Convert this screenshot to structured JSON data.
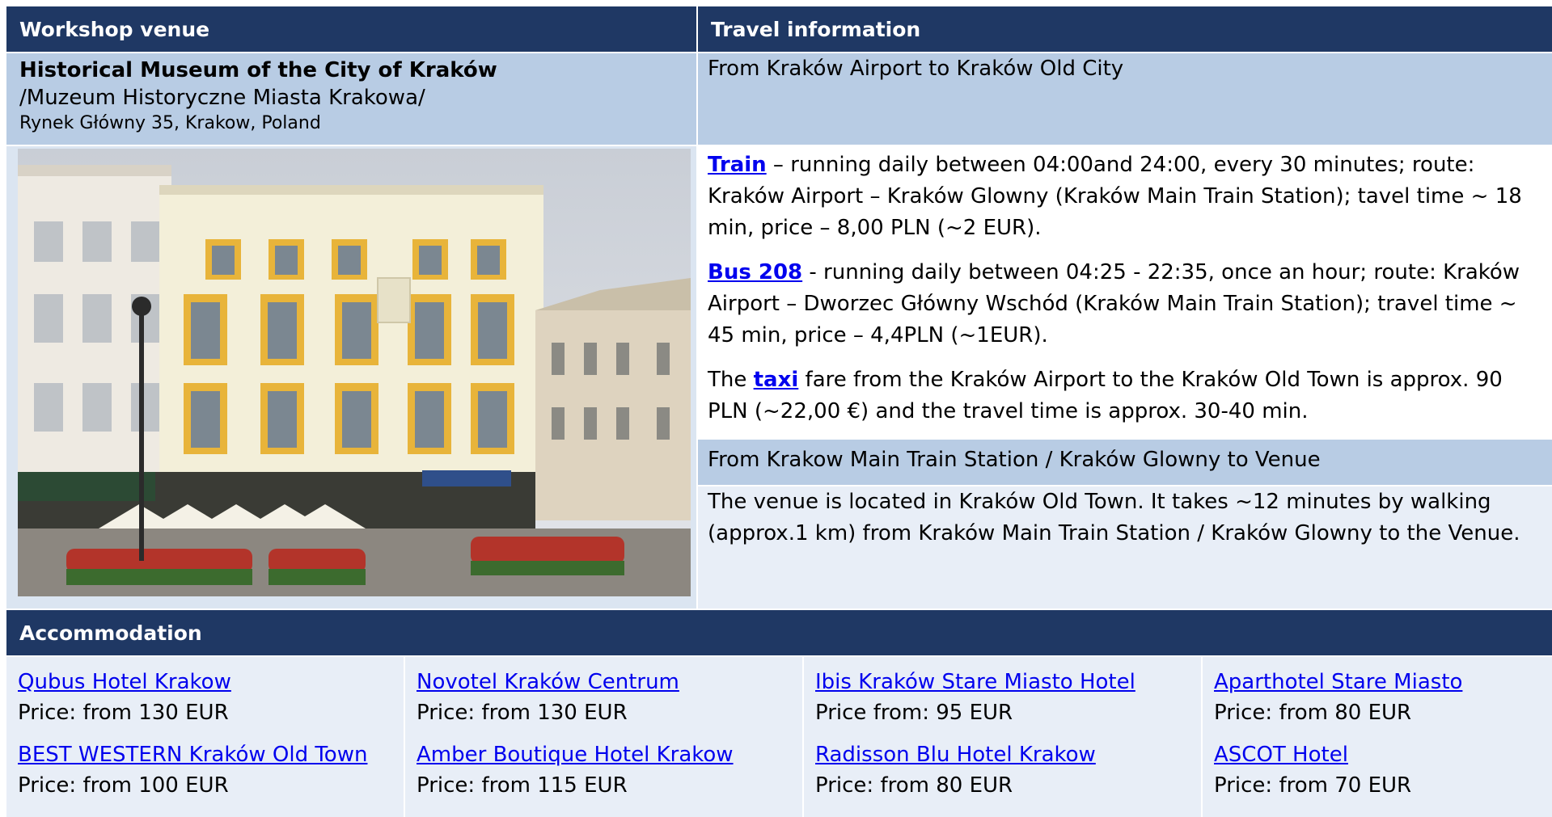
{
  "venue": {
    "header": "Workshop venue",
    "name": "Historical Museum of the City of Kraków",
    "native_name": "/Muzeum Historyczne Miasta Krakowa/",
    "address": "Rynek Główny 35, Krakow, Poland"
  },
  "travel": {
    "header": "Travel information",
    "section1_title": "From Kraków Airport to Kraków Old City",
    "train_link": "Train",
    "train_text": " – running daily between 04:00and 24:00, every 30 minutes; route: Kraków Airport – Kraków Glowny (Kraków Main Train Station); tavel time ~ 18 min, price – 8,00 PLN (~2 EUR).",
    "bus_link": "Bus 208",
    "bus_text": " - running daily between 04:25 - 22:35, once an hour; route: Kraków Airport – Dworzec Główny Wschód (Kraków Main Train Station); travel time ~ 45 min, price – 4,4PLN (~1EUR).",
    "taxi_prefix": "The ",
    "taxi_link": "taxi",
    "taxi_text": " fare from the Kraków Airport to the Kraków Old Town is approx. 90 PLN (~22,00 €) and the travel time is approx. 30-40 min.",
    "section2_title": "From  Krakow Main Train Station / Kraków Glowny to Venue",
    "section2_text": "The venue is located in Kraków Old Town. It takes ~12 minutes by walking (approx.1 km) from Kraków Main Train Station / Kraków Glowny to the Venue."
  },
  "accommodation": {
    "header": "Accommodation",
    "columns": [
      {
        "hotels": [
          {
            "name": "Qubus Hotel Krakow",
            "price": "Price: from 130 EUR"
          },
          {
            "name": "BEST WESTERN Kraków Old Town ",
            "price": "Price: from 100 EUR"
          }
        ]
      },
      {
        "hotels": [
          {
            "name": "Novotel Kraków Centrum",
            "price": "Price: from 130 EUR"
          },
          {
            "name": "Amber Boutique Hotel Krakow",
            "price": "Price: from 115 EUR"
          }
        ]
      },
      {
        "hotels": [
          {
            "name": "Ibis Kraków Stare Miasto Hotel",
            "price": "Price from: 95 EUR"
          },
          {
            "name": "Radisson Blu Hotel Krakow",
            "price": "Price: from 80 EUR"
          }
        ]
      },
      {
        "hotels": [
          {
            "name": "Aparthotel Stare Miasto",
            "price": "Price: from 80 EUR"
          },
          {
            "name": "ASCOT Hotel",
            "price": "Price: from 70 EUR"
          }
        ]
      }
    ]
  },
  "colors": {
    "header_bg": "#1f3864",
    "light_cell": "#b8cce4",
    "pale_cell": "#dbe5f1",
    "link": "#0000ee"
  }
}
